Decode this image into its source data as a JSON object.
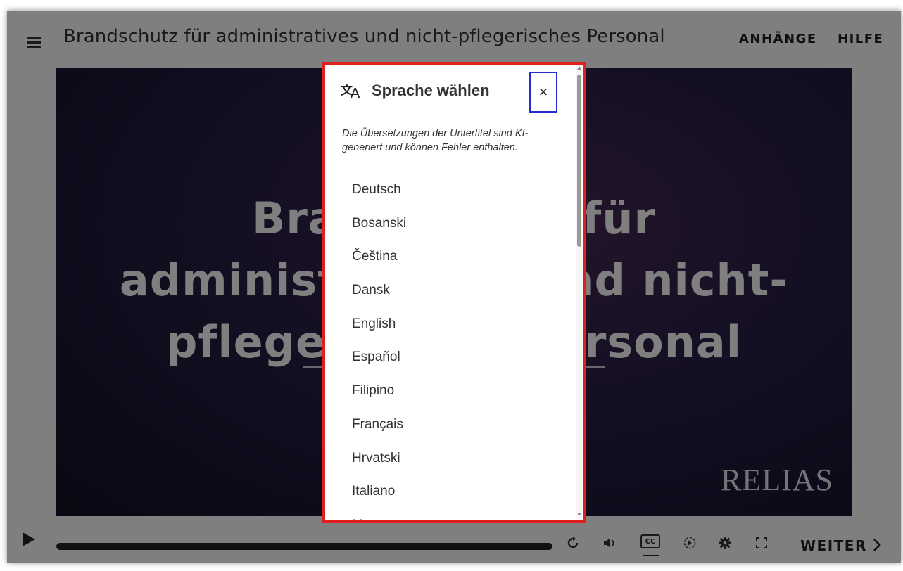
{
  "header": {
    "title": "Brandschutz für administratives und nicht-pflegerisches Personal",
    "attachments_label": "ANHÄNGE",
    "help_label": "HILFE"
  },
  "video": {
    "title_lines": [
      "Brandschutz für",
      "administratives und nicht-",
      "pflegerisches Personal"
    ],
    "brand": "RELIAS"
  },
  "controls": {
    "cc_label": "CC",
    "next_label": "WEITER"
  },
  "language_dialog": {
    "title": "Sprache wählen",
    "close_glyph": "×",
    "note": "Die Übersetzungen der Untertitel sind KI-generiert und können Fehler enthalten.",
    "languages": [
      "Deutsch",
      "Bosanski",
      "Čeština",
      "Dansk",
      "English",
      "Español",
      "Filipino",
      "Français",
      "Hrvatski",
      "Italiano",
      "M"
    ]
  },
  "icons": {
    "menu": "hamburger-icon",
    "translate": "translate-icon",
    "replay": "replay-icon",
    "volume": "volume-icon",
    "speed": "playback-speed-icon",
    "settings": "gear-icon",
    "fullscreen": "fullscreen-icon",
    "next": "chevron-right-icon"
  },
  "colors": {
    "dialog_highlight_border": "#e0201e",
    "close_highlight_border": "#1f2ecf"
  }
}
